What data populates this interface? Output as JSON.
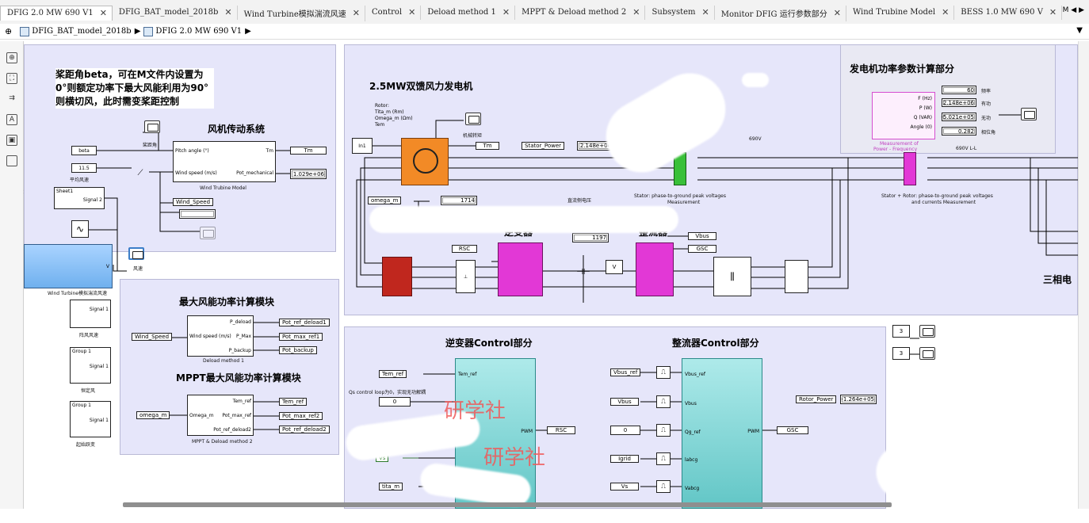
{
  "tabs": [
    {
      "label": "DFIG  2.0 MW 690 V1",
      "active": true
    },
    {
      "label": "DFIG_BAT_model_2018b"
    },
    {
      "label": "Wind Turbine模拟湍流风速"
    },
    {
      "label": "Control"
    },
    {
      "label": "Deload method 1"
    },
    {
      "label": "MPPT & Deload method 2"
    },
    {
      "label": "Subsystem"
    },
    {
      "label": "Monitor DFIG 运行参数部分"
    },
    {
      "label": "Wind Trubine Model"
    },
    {
      "label": "BESS 1.0 MW 690 V"
    }
  ],
  "tab_overflow": "M ◀ ▶",
  "breadcrumb": {
    "items": [
      "DFIG_BAT_model_2018b",
      "DFIG  2.0 MW 690 V1"
    ],
    "sep": "▶"
  },
  "notes": {
    "pitch": "桨距角beta，可在M文件内设置为0°则额定功率下最大风能利用为90°则横切风，此时需变桨距控制",
    "drive_title": "风机传动系统",
    "gen_title": "2.5MW双馈风力发电机",
    "power_calc_title": "发电机功率参数计算部分",
    "max_power_title": "最大风能功率计算模块",
    "mppt_title": "MPPT最大风能功率计算模块",
    "inverter_ctrl_title": "逆变器Control部分",
    "rectifier_ctrl_title": "整流器Control部分",
    "inverter": "逆变器",
    "rectifier": "整流器",
    "three_phase": "三相电"
  },
  "blocks": {
    "beta": "beta",
    "avg_wind": "11.5",
    "avg_wind_label": "平均风速",
    "pitch_angle_label": "桨距角",
    "turbine_ports": {
      "pitch": "Pitch angle (°)",
      "wind": "Wind speed (m/s)",
      "tm": "Tm",
      "pot": "Pot_mechanical"
    },
    "turbine_label": "Wind Trubine Model",
    "tm_tag": "Tm",
    "pot_value": "1.029e+06",
    "wind_speed_tag": "Wind_Speed",
    "sheet1": "Sheet1",
    "signal2": "Signal 2",
    "wind_turbine_label": "Wind Turbine模拟湍流风速",
    "wind_v": "V",
    "wind_scope_label": "风速",
    "signal1": "Signal 1",
    "group1": "Group 1",
    "gust_label": "阵风风速",
    "const_label": "恒定风",
    "ramp_label": "起始跃变",
    "deload_ports": {
      "wind": "Wind speed (m/s)",
      "pdeload": "P_deload",
      "pmax": "P_Max",
      "pbackup": "P_backup"
    },
    "deload_label": "Deload method 1",
    "deload_in": "Wind_Speed",
    "deload_outs": [
      "Pot_ref_deload1",
      "Pot_max_ref1",
      "Pot_backup"
    ],
    "mppt_ports": {
      "omega": "Omega_m",
      "tem": "Tem_ref",
      "pmax": "Pot_max_ref",
      "pdel": "Pot_ref_deload2"
    },
    "mppt_label": "MPPT & Deload method 2",
    "mppt_in": "omega_m",
    "mppt_outs": [
      "Tem_ref",
      "Pot_max_ref2",
      "Pot_ref_deload2"
    ],
    "rotor_list": [
      "Rotor:",
      "Tita_m (Rm)",
      "Omega_m (Ωm)",
      "Tem"
    ],
    "in1": "In1",
    "mech_label": "机械转矩",
    "stator_power_tag": "Stator_Power",
    "stator_power_val": "2.148e+06",
    "v690": "690V",
    "stator_meas": "Stator: phase-to-ground peak voltages",
    "measurement": "Measurement",
    "omega_tag": "omega_m",
    "omega_val": "1714",
    "dc_label": "直流侧电压",
    "vdc_val": "1197",
    "vbus_tag": "Vbus",
    "gsc_tag": "GSC",
    "rsc_tag": "RSC",
    "stator_rotor_meas": "Stator + Rotor: phase-to-ground peak voltages",
    "stator_rotor_meas2": "and currents Measurement",
    "pq_ports": [
      "F (Hz)",
      "P (W)",
      "Q (VAR)",
      "Angle (0)"
    ],
    "pq_label1": "Measurement of",
    "pq_label2": "Power - Frequency",
    "pq_vals": [
      "60",
      "2.148e+06",
      "-5.021e+05",
      "0.282"
    ],
    "pq_names": [
      "频率",
      "有功",
      "无功",
      "相位角"
    ],
    "v690ll": "690V L-L",
    "three_val": "3",
    "inv_in": [
      "Tem_ref",
      "Qs control loop为0，实现无功解耦",
      "0",
      "Vs",
      "tita_m"
    ],
    "inv_ports": [
      "Tem_ref",
      "PWM"
    ],
    "rsc_out": "RSC",
    "rec_in": [
      "Vbus_ref",
      "Vbus",
      "0",
      "Igrid",
      "Vs"
    ],
    "rec_ports": [
      "Vbus_ref",
      "Vbus",
      "Qg_ref",
      "labcg",
      "Vabcg",
      "PWM"
    ],
    "gsc_out": "GSC",
    "rotor_power_tag": "Rotor_Power",
    "rotor_power_val": "-1.264e+05"
  },
  "watermarks": [
    "研学社",
    "研学社"
  ]
}
